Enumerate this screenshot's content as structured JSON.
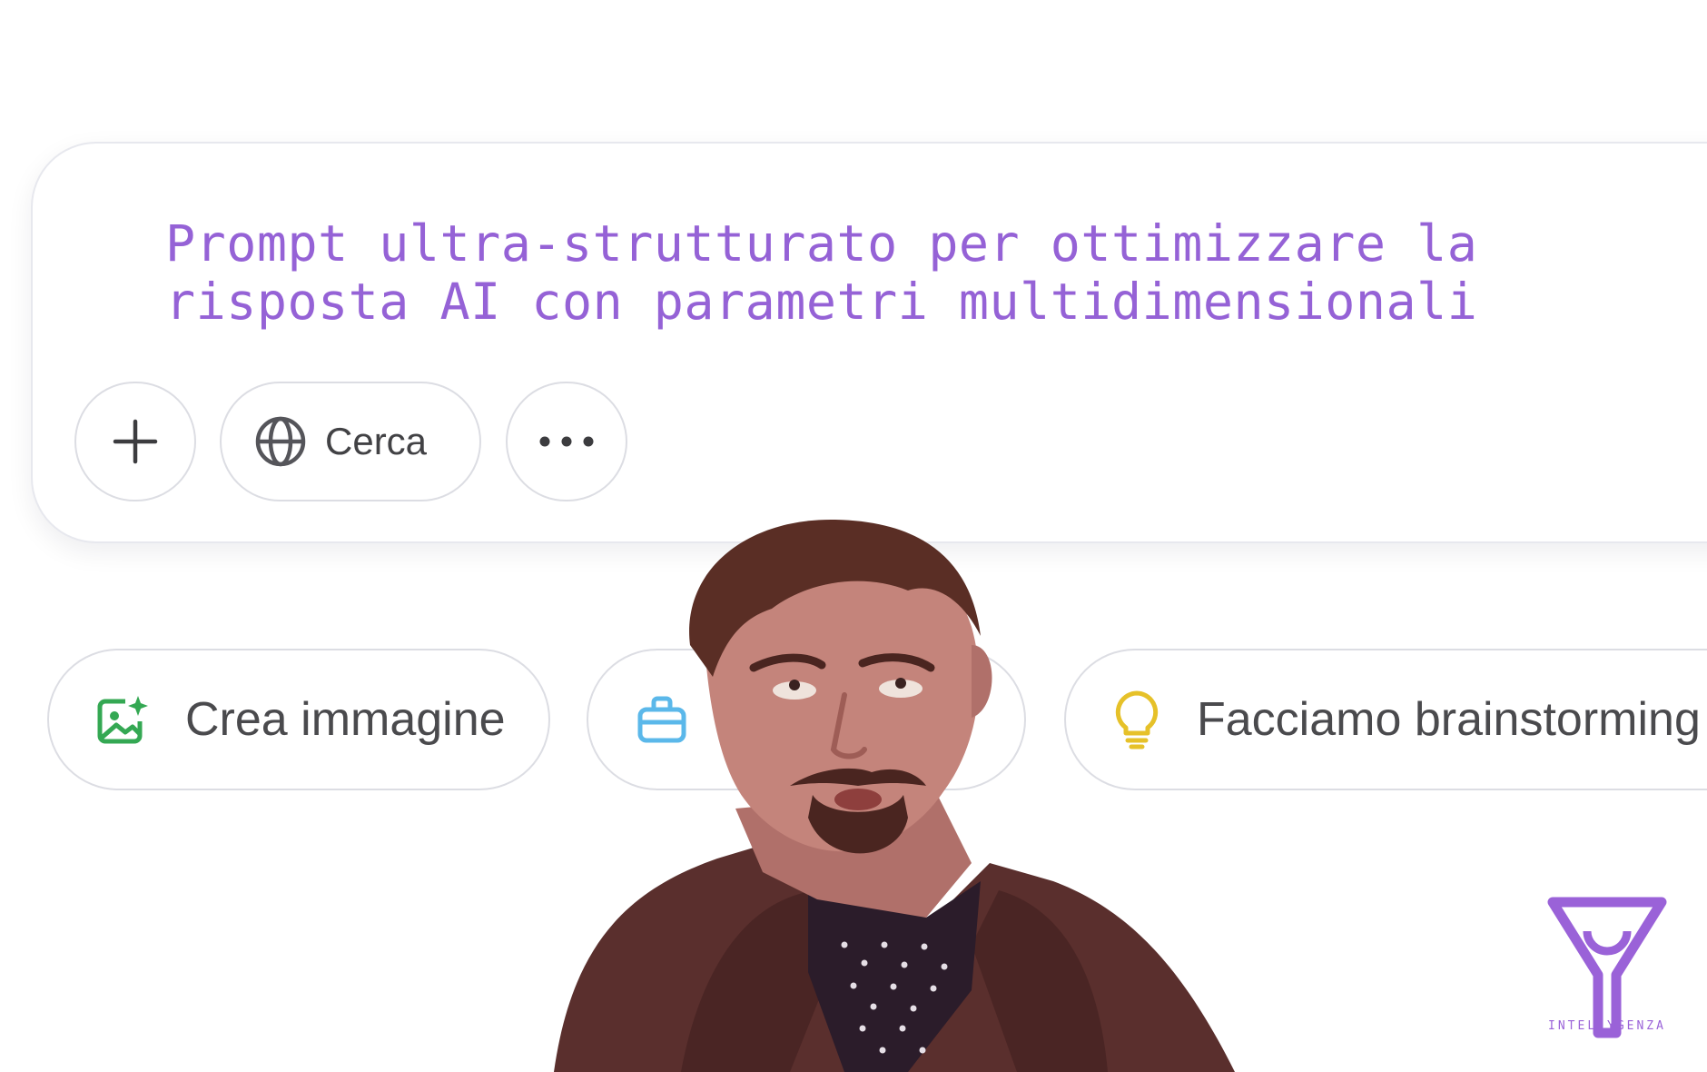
{
  "composer": {
    "prompt_text": "Prompt ultra-strutturato per ottimizzare la\nrisposta AI con parametri multidimensionali",
    "prompt_color": "#9562d6",
    "add_icon": "plus-icon",
    "search_icon": "globe-icon",
    "search_label": "Cerca",
    "more_icon": "ellipsis-icon"
  },
  "suggestions": {
    "items": [
      {
        "label": "Crea immagine",
        "icon": "image-sparkle-icon",
        "icon_color": "#34a853"
      },
      {
        "label": "",
        "icon": "briefcase-icon",
        "icon_color": "#5bb8ea"
      },
      {
        "label": "Facciamo brainstorming",
        "icon": "lightbulb-icon",
        "icon_color": "#e6c129"
      }
    ]
  },
  "brand": {
    "logo_icon": "y-funnel-logo",
    "wordmark": "INTELLYGENZA",
    "color": "#9a62d8"
  }
}
